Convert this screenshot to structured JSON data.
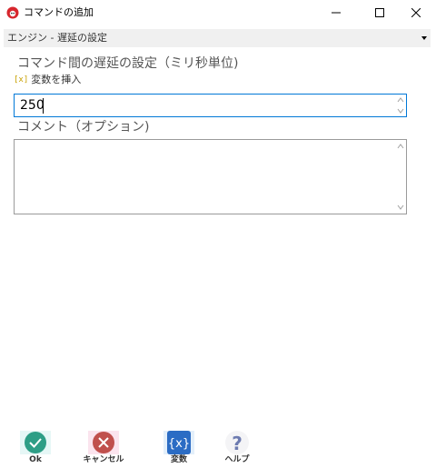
{
  "window": {
    "title": "コマンドの追加"
  },
  "selector": {
    "value": "エンジン - 遅延の設定"
  },
  "delay_field": {
    "label": "コマンド間の遅延の設定（ミリ秒単位)",
    "insert_variable_label": "変数を挿入",
    "insert_variable_icon_text": "[x]",
    "value": "250"
  },
  "comment_field": {
    "label": "コメント（オプション)",
    "value": ""
  },
  "buttons": {
    "ok": "Ok",
    "cancel": "キャンセル",
    "variables": "変数",
    "variables_icon_text": "{x}",
    "help": "ヘルプ"
  },
  "colors": {
    "ok": "#2e9e86",
    "cancel": "#c0504d",
    "variables": "#2b6cc4",
    "help": "#6d7bb0",
    "focus_border": "#0078d7"
  }
}
